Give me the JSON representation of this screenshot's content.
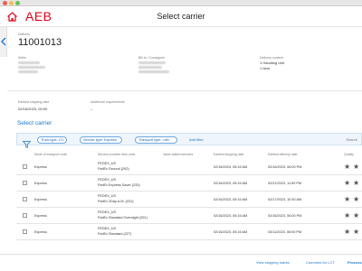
{
  "app": {
    "brand": "AEB",
    "title": "Select carrier"
  },
  "delivery": {
    "label": "Delivery",
    "id": "11001013"
  },
  "parties": {
    "seller_label": "Seller",
    "billto_label": "Bill to / Consignee",
    "content_label": "Delivery content",
    "content_line1": "1 Handling Unit",
    "content_line2": "1 Item"
  },
  "shipping": {
    "earliest_label": "Earliest shipping date",
    "earliest_value": "02/16/2023, 00:00",
    "requirements_label": "Additional requirements",
    "requirements_value": "–"
  },
  "section_title": "Select carrier",
  "filters": {
    "chips": [
      {
        "label": "Truck type: LTL"
      },
      {
        "label": "Service type: Express"
      },
      {
        "label": "Transport type: <all>"
      }
    ],
    "add_label": "Add filter",
    "search_label": "Search"
  },
  "table": {
    "columns": [
      "Mode of transport code",
      "Service provider item code",
      "Value added services",
      "Earliest shipping date",
      "Earliest delivery date",
      "Quality"
    ],
    "rows": [
      {
        "mode": "Express",
        "provider": "FEDEX_US",
        "service": "FedEx Ground (292)",
        "ship": "02/16/2023, 05:15 AM",
        "deliver": "02/16/2023, 06:00 PM"
      },
      {
        "mode": "Express",
        "provider": "FEDEX_US",
        "service": "FedEx Express Saver (233)",
        "ship": "02/16/2023, 05:15 AM",
        "deliver": "02/21/2023, 11:59 PM"
      },
      {
        "mode": "Express",
        "provider": "FEDEX_US",
        "service": "FedEx 2Day A.M. (231)",
        "ship": "02/16/2023, 05:15 AM",
        "deliver": "02/17/2023, 10:30 AM"
      },
      {
        "mode": "Express",
        "provider": "FEDEX_US",
        "service": "FedEx Standard Overnight (251)",
        "ship": "02/16/2023, 05:15 AM",
        "deliver": "02/16/2023, 06:00 PM"
      },
      {
        "mode": "Express",
        "provider": "FEDEX_US",
        "service": "FedEx Standard (227)",
        "ship": "02/16/2023, 05:15 AM",
        "deliver": "03/11/2023, 06:00 PM"
      }
    ]
  },
  "footer": {
    "marks_label": "View shipping marks",
    "comment_label": "Comment for LCT",
    "process_label": "Process"
  },
  "colors": {
    "brand_red": "#e2001a",
    "accent_blue": "#1a76c9"
  }
}
